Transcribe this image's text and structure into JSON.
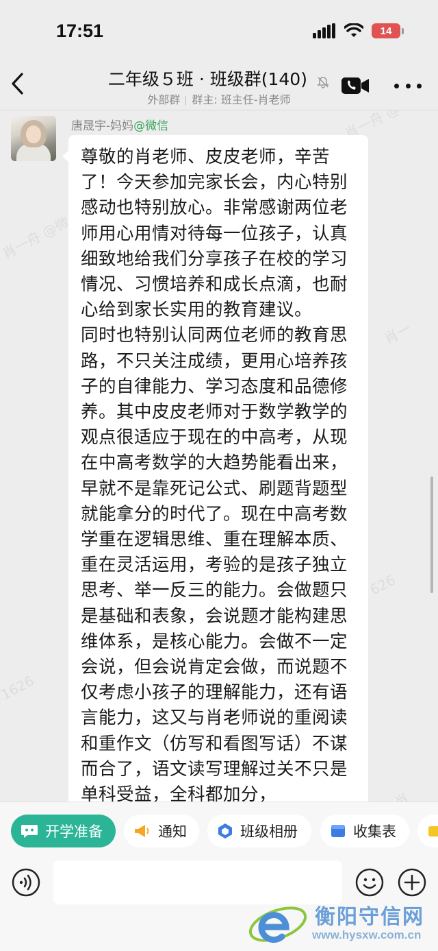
{
  "status_bar": {
    "time": "17:51",
    "battery": "14",
    "icons": [
      "signal-icon",
      "wifi-icon",
      "battery-icon"
    ]
  },
  "header": {
    "title": "二年级５班 · 班级群(140)",
    "subtitle_left": "外部群",
    "subtitle_right": "群主: 班主任-肖老师",
    "icons": [
      "back-arrow-icon",
      "mute-bell-icon",
      "video-call-icon",
      "more-icon"
    ]
  },
  "message": {
    "sender": "唐晟宇-妈妈",
    "source": "@微信",
    "paragraphs": [
      "尊敬的肖老师、皮皮老师，辛苦了！今天参加完家长会，内心特别感动也特别放心。非常感谢两位老师用心用情对待每一位孩子，认真细致地给我们分享孩子在校的学习情况、习惯培养和成长点滴，也耐心给到家长实用的教育建议。",
      "同时也特别认同两位老师的教育思路，不只关注成绩，更用心培养孩子的自律能力、学习态度和品德修养。其中皮皮老师对于数学教学的观点很适应于现在的中高考，从现在中高考数学的大趋势能看出来，早就不是靠死记公式、刷题背题型就能拿分的时代了。现在中高考数学重在逻辑思维、重在理解本质、重在灵活运用，考验的是孩子独立思考、举一反三的能力。会做题只是基础和表象，会说题才能构建思维体系，是核心能力。会做不一定会说，但会说肯定会做，而说题不仅考虑小孩子的理解能力，还有语言能力，这又与肖老师说的重阅读和重作文（仿写和看图写话）不谋而合了，语文读写理解过关不只是单科受益，全科都加分，"
    ]
  },
  "quick_actions": [
    {
      "label": "开学准备",
      "icon": "chat-bot-icon",
      "active": true
    },
    {
      "label": "通知",
      "icon": "megaphone-icon",
      "active": false
    },
    {
      "label": "班级相册",
      "icon": "album-icon",
      "active": false
    },
    {
      "label": "收集表",
      "icon": "form-icon",
      "active": false
    }
  ],
  "input_bar": {
    "placeholder": "",
    "icons": [
      "voice-icon",
      "emoji-icon",
      "plus-icon"
    ]
  },
  "logo": {
    "name": "衡阳守信网",
    "url": "www.hysxw.com.cn"
  },
  "colors": {
    "background": "#ededed",
    "accent_green": "#2bb596",
    "source_green": "#3aa55d",
    "battery_red": "#e05353"
  }
}
